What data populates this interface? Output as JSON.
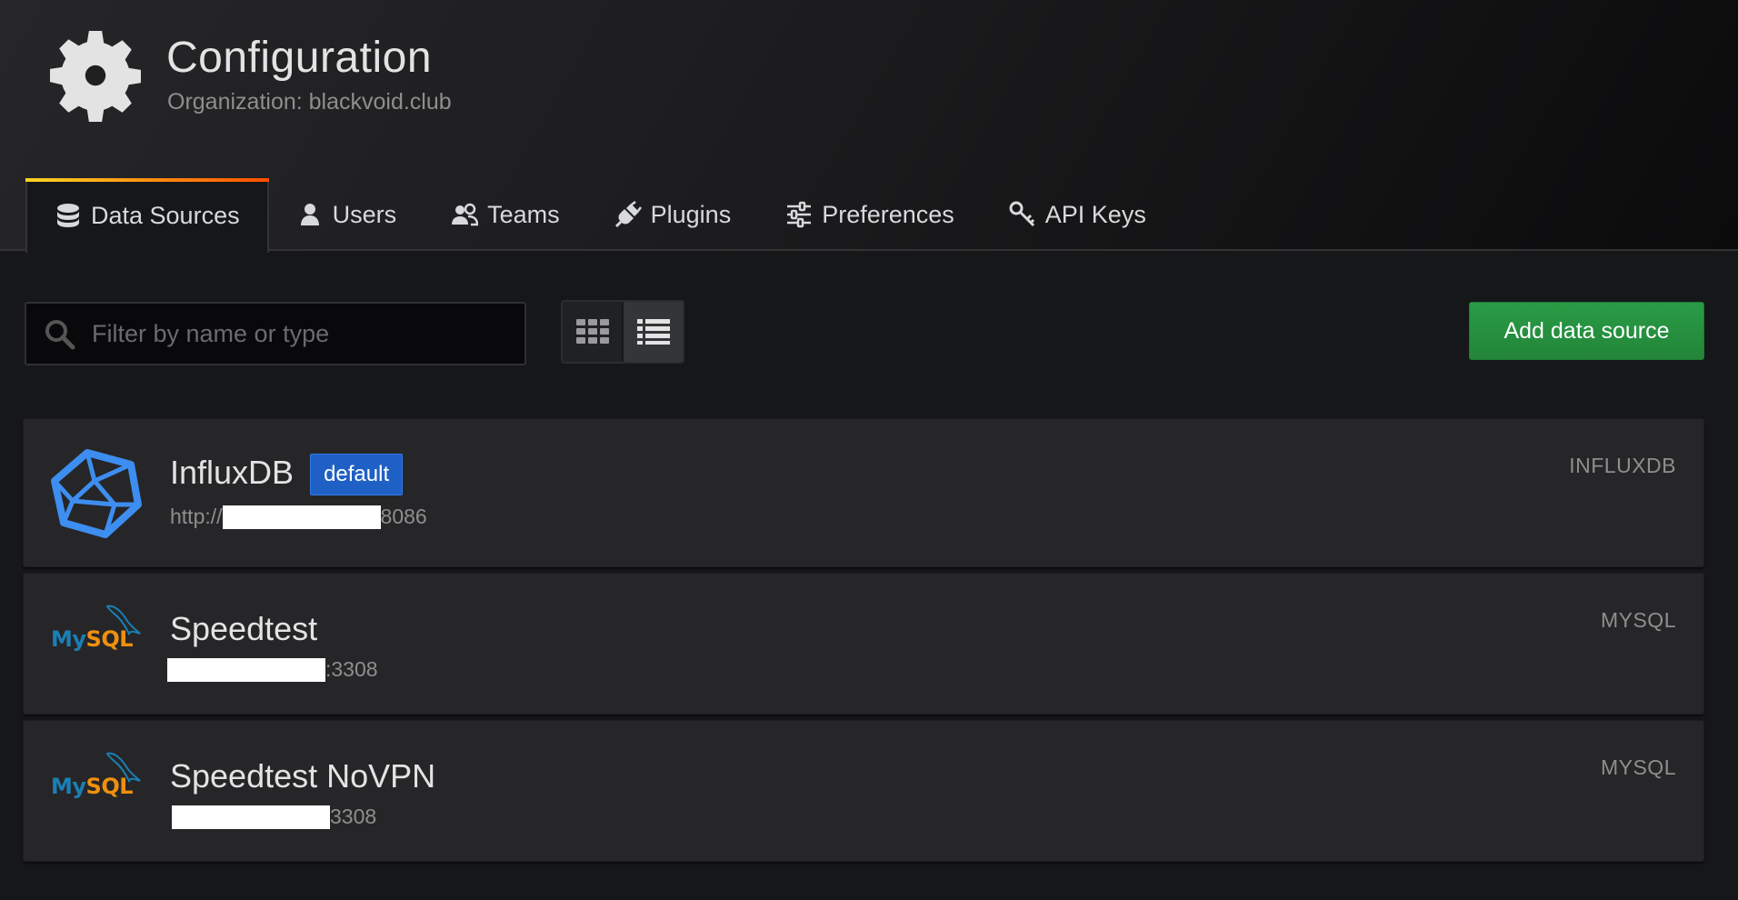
{
  "header": {
    "title": "Configuration",
    "subtitle": "Organization: blackvoid.club",
    "icon": "gear-icon"
  },
  "tabs": [
    {
      "label": "Data Sources",
      "icon": "database-icon",
      "active": true
    },
    {
      "label": "Users",
      "icon": "user-icon",
      "active": false
    },
    {
      "label": "Teams",
      "icon": "users-icon",
      "active": false
    },
    {
      "label": "Plugins",
      "icon": "plug-icon",
      "active": false
    },
    {
      "label": "Preferences",
      "icon": "sliders-icon",
      "active": false
    },
    {
      "label": "API Keys",
      "icon": "key-icon",
      "active": false
    }
  ],
  "toolbar": {
    "search_placeholder": "Filter by name or type",
    "add_label": "Add data source"
  },
  "datasources": [
    {
      "name": "InfluxDB",
      "badge": "default",
      "url_prefix": "http://",
      "url_suffix": "8086",
      "type": "INFLUXDB",
      "logo": "influxdb-logo-icon"
    },
    {
      "name": "Speedtest",
      "url_prefix": "",
      "url_suffix": ":3308",
      "type": "MYSQL",
      "logo": "mysql-logo-icon"
    },
    {
      "name": "Speedtest NoVPN",
      "url_prefix": "",
      "url_suffix": "3308",
      "type": "MYSQL",
      "logo": "mysql-logo-icon"
    }
  ],
  "logos": {
    "mysql_my": "My",
    "mysql_sql": "SQL"
  },
  "colors": {
    "accent_green": "#299c46",
    "badge_blue": "#1f60c4",
    "influx_blue": "#3d8ef0"
  }
}
